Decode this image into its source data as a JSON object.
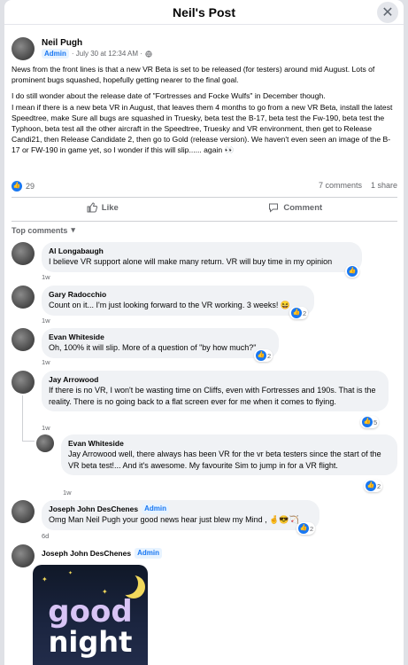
{
  "modal": {
    "title": "Neil's Post",
    "close_glyph": "✕"
  },
  "post": {
    "author": "Neil Pugh",
    "badge": "Admin",
    "timestamp": "· July 30 at 12:34 AM ·",
    "paragraphs": [
      "News from the front lines is that a new VR Beta is set to be released (for testers) around mid August. Lots of prominent bugs squashed, hopefully getting nearer to the final goal.",
      "I do still wonder about the release date of \"Fortresses and Focke Wulfs\" in December though.",
      "I mean if there is a new beta VR in August, that leaves them 4 months to go from a new VR Beta, install the latest Speedtree, make Sure all bugs are squashed in Truesky, beta test the B-17, beta test the Fw-190, beta test the Typhoon, beta test all the other aircraft in the Speedtree, Truesky and VR environment, then get to Release Candi21, then Release Candidate 2, then go to Gold (release version). We haven't even seen an image of the B-17 or FW-190 in game yet, so I wonder if this will slip...... again 👀"
    ],
    "reaction_count": "29",
    "comments_count": "7 comments",
    "shares_count": "1 share"
  },
  "actions": {
    "like": "Like",
    "comment": "Comment"
  },
  "top_comments_label": "Top comments",
  "comments": [
    {
      "name": "Al Longabaugh",
      "badge": "",
      "text": "I believe VR support alone will make many return. VR will buy time in my opinion",
      "time": "1w",
      "reactions": ""
    },
    {
      "name": "Gary Radocchio",
      "badge": "",
      "text": "Count on it... I'm just looking forward to the VR working. 3 weeks! 😆",
      "time": "1w",
      "reactions": "2"
    },
    {
      "name": "Evan Whiteside",
      "badge": "",
      "text": "Oh, 100% it will slip. More of a question of \"by how much?\"",
      "time": "1w",
      "reactions": "2"
    },
    {
      "name": "Jay Arrowood",
      "badge": "",
      "text": "If there is no VR, I won't be wasting time on Cliffs, even with Fortresses and 190s. That is the reality. There is no going back to a flat screen ever for me when it comes to flying.",
      "time": "1w",
      "reactions": "5"
    },
    {
      "name": "Evan Whiteside",
      "badge": "",
      "text": "Jay Arrowood well, there always has been VR for the vr beta testers since the start of the VR beta test!... And it's awesome. My favourite Sim to jump in for a VR flight.",
      "time": "1w",
      "reactions": "2"
    },
    {
      "name": "Joseph John DesChenes",
      "badge": "Admin",
      "text": "Omg Man Neil Pugh your good news hear just blew my Mind , 🤞😎🏹",
      "time": "6d",
      "reactions": "2"
    },
    {
      "name": "Joseph John DesChenes",
      "badge": "Admin",
      "text": "",
      "time": "",
      "reactions": ""
    }
  ],
  "gif": {
    "line1": "good",
    "line2": "night"
  },
  "colors": {
    "accent": "#1877f2",
    "bubble": "#f0f2f5",
    "muted": "#65676b"
  }
}
